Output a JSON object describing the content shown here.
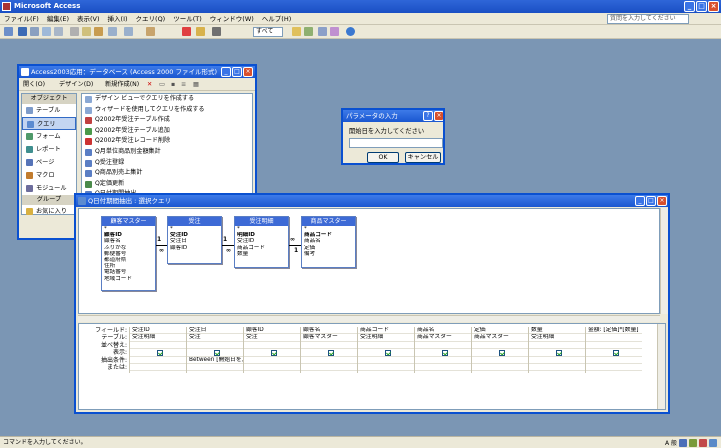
{
  "app": {
    "title": "Microsoft Access",
    "help_placeholder": "質問を入力してください"
  },
  "menu": [
    "ファイル(F)",
    "編集(E)",
    "表示(V)",
    "挿入(I)",
    "クエリ(Q)",
    "ツール(T)",
    "ウィンドウ(W)",
    "ヘルプ(H)"
  ],
  "toolbar": {
    "select_value": "すべて"
  },
  "db_window": {
    "title": "Access2003応用：データベース (Access 2000 ファイル形式)",
    "toolbar": {
      "open": "開く(O)",
      "design": "デザイン(D)",
      "new": "新規作成(N)"
    },
    "objects_header": "オブジェクト",
    "groups_header": "グループ",
    "nav_items": [
      "テーブル",
      "クエリ",
      "フォーム",
      "レポート",
      "ページ",
      "マクロ",
      "モジュール"
    ],
    "group_items": [
      "お気に入り"
    ],
    "list_items": [
      "デザイン ビューでクエリを作成する",
      "ウィザードを使用してクエリを作成する",
      "Q2002年受注テーブル作成",
      "Q2002年受注テーブル追加",
      "Q2002年受注レコード削除",
      "Q月単位商品別金額集計",
      "Q受注登録",
      "Q商品別売上集計",
      "Q定価更新",
      "Q日付期間抽出"
    ]
  },
  "dialog": {
    "title": "パラメータの入力",
    "prompt": "開始日を入力してください",
    "ok": "OK",
    "cancel": "キャンセル"
  },
  "query_window": {
    "title": "Q日付期間抽出 : 選択クエリ",
    "tables": [
      {
        "name": "顧客マスター",
        "fields": [
          "*",
          "顧客ID",
          "顧客名",
          "ふりがな",
          "郵便番号",
          "都道府県",
          "住所",
          "電話番号",
          "地域コード"
        ]
      },
      {
        "name": "受注",
        "fields": [
          "*",
          "受注ID",
          "受注日",
          "顧客ID"
        ]
      },
      {
        "name": "受注明細",
        "fields": [
          "*",
          "明細ID",
          "受注ID",
          "商品コード",
          "数量"
        ]
      },
      {
        "name": "商品マスター",
        "fields": [
          "*",
          "商品コード",
          "商品名",
          "定価",
          "備考"
        ]
      }
    ],
    "relations": [
      {
        "one": "1",
        "many": "∞"
      },
      {
        "one": "1",
        "many": "∞"
      },
      {
        "one": "∞",
        "many": "1"
      }
    ],
    "grid_row_labels": [
      "フィールド:",
      "テーブル:",
      "並べ替え:",
      "表示:",
      "抽出条件:",
      "または:"
    ],
    "grid_columns": [
      {
        "field": "受注ID",
        "table": "受注明細",
        "show": true,
        "criteria": ""
      },
      {
        "field": "受注日",
        "table": "受注",
        "show": true,
        "criteria": "Between [開始日を入"
      },
      {
        "field": "顧客ID",
        "table": "受注",
        "show": true,
        "criteria": ""
      },
      {
        "field": "顧客名",
        "table": "顧客マスター",
        "show": true,
        "criteria": ""
      },
      {
        "field": "商品コード",
        "table": "受注明細",
        "show": true,
        "criteria": ""
      },
      {
        "field": "商品名",
        "table": "商品マスター",
        "show": true,
        "criteria": ""
      },
      {
        "field": "定価",
        "table": "商品マスター",
        "show": true,
        "criteria": ""
      },
      {
        "field": "数量",
        "table": "受注明細",
        "show": true,
        "criteria": ""
      },
      {
        "field": "金額: [定価]*[数量]",
        "table": "",
        "show": true,
        "criteria": ""
      }
    ]
  },
  "status": {
    "text": "コマンドを入力してください。",
    "ime": "A 般"
  }
}
